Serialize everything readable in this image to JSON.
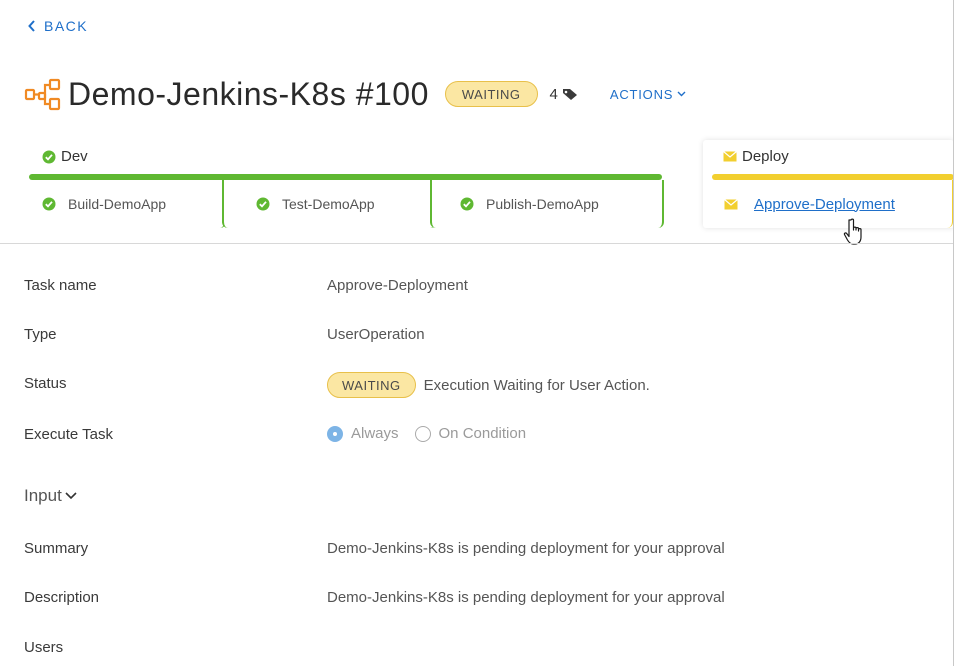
{
  "nav": {
    "back_label": "BACK"
  },
  "header": {
    "title": "Demo-Jenkins-K8s #100",
    "status": "WAITING",
    "tag_count": "4",
    "actions_label": "ACTIONS"
  },
  "stages": [
    {
      "name": "Dev",
      "color": "#5fb832",
      "tasks": [
        "Build-DemoApp",
        "Test-DemoApp",
        "Publish-DemoApp"
      ]
    },
    {
      "name": "Deploy",
      "color": "#f2cf2f",
      "tasks": [
        "Approve-Deployment"
      ]
    }
  ],
  "details": {
    "rows": [
      {
        "label": "Task name",
        "value": "Approve-Deployment"
      },
      {
        "label": "Type",
        "value": "UserOperation"
      },
      {
        "label": "Status",
        "badge": "WAITING",
        "value": "Execution Waiting for User Action."
      },
      {
        "label": "Execute Task",
        "option_selected": "Always",
        "option_other": "On Condition"
      }
    ],
    "input_section_label": "Input",
    "input_rows": [
      {
        "label": "Summary",
        "value": "Demo-Jenkins-K8s is pending deployment for your approval"
      },
      {
        "label": "Description",
        "value": "Demo-Jenkins-K8s is pending deployment for your approval"
      },
      {
        "label": "Users",
        "value": ""
      }
    ]
  },
  "colors": {
    "accent": "#1f6fc9",
    "success": "#5fb832",
    "waiting": "#fbe7a3",
    "deploy": "#f2cf2f"
  },
  "icons": [
    "chevron-left-icon",
    "pipeline-icon",
    "tag-icon",
    "chevron-down-icon",
    "check-circle-icon",
    "envelope-icon",
    "hand-cursor-icon"
  ]
}
